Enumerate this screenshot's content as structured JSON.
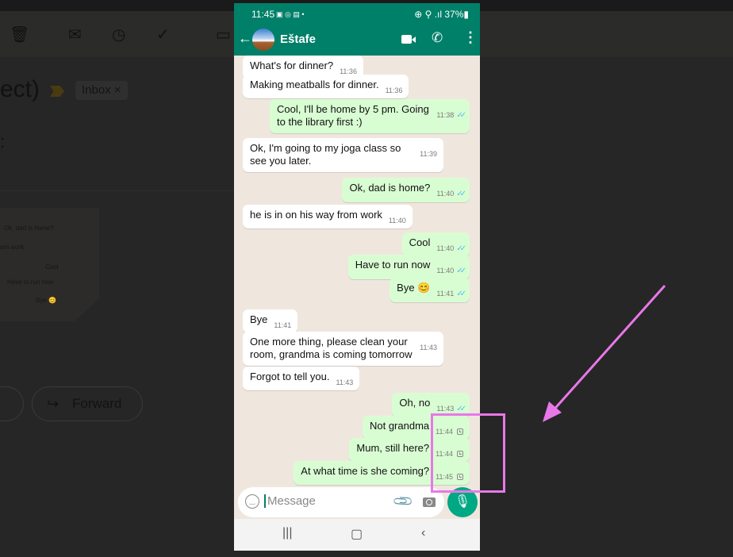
{
  "background_email": {
    "toolbar_icons": [
      "trash-icon",
      "mail-icon",
      "clock-icon",
      "add-task-icon",
      "move-to-folder-icon"
    ],
    "subject_fragment": "ect)",
    "label_chip": "Inbox",
    "label_chip_close": "×",
    "colon": ":",
    "thumbnail_messages": [
      {
        "text": "Ok, dad is home?",
        "time": "11:40"
      },
      {
        "text": "om work",
        "time": "11:40"
      },
      {
        "text": "Cool",
        "time": "11:40"
      },
      {
        "text": "Have to run now",
        "time": "11:40"
      },
      {
        "text": "Bye 😊",
        "time": "11:41"
      }
    ],
    "forward_label": "Forward"
  },
  "phone": {
    "status": {
      "time": "11:45",
      "icons": "▣ ◎ ▤ •",
      "right": "⊕ ⚲ .ıl 37%▮",
      "battery": "37%"
    },
    "header": {
      "contact_name": "Eštafe"
    },
    "messages": [
      {
        "dir": "in",
        "text": "What's for dinner?",
        "time": "11:36"
      },
      {
        "dir": "in",
        "text": "Making meatballs for dinner.",
        "time": "11:36"
      },
      {
        "dir": "out",
        "text": "Cool, I'll be home by 5 pm. Going to the library first :)",
        "time": "11:38",
        "status": "read"
      },
      {
        "dir": "in",
        "text": "Ok, I'm going to my joga class so see you later.",
        "time": "11:39"
      },
      {
        "dir": "out",
        "text": "Ok, dad is home?",
        "time": "11:40",
        "status": "read"
      },
      {
        "dir": "in",
        "text": "he is in on his way from work",
        "time": "11:40"
      },
      {
        "dir": "out",
        "text": "Cool",
        "time": "11:40",
        "status": "read"
      },
      {
        "dir": "out",
        "text": "Have to run now",
        "time": "11:40",
        "status": "read"
      },
      {
        "dir": "out",
        "text": "Bye 😊",
        "time": "11:41",
        "status": "read"
      },
      {
        "dir": "in",
        "text": "Bye",
        "time": "11:41"
      },
      {
        "dir": "in",
        "text": "One more thing, please clean your room, grandma is coming tomorrow",
        "time": "11:43"
      },
      {
        "dir": "in",
        "text": "Forgot to tell you.",
        "time": "11:43"
      },
      {
        "dir": "out",
        "text": "Oh, no",
        "time": "11:43",
        "status": "read"
      },
      {
        "dir": "out",
        "text": "Not grandma",
        "time": "11:44",
        "status": "pending"
      },
      {
        "dir": "out",
        "text": "Mum, still here?",
        "time": "11:44",
        "status": "pending"
      },
      {
        "dir": "out",
        "text": "At what time is she coming?",
        "time": "11:45",
        "status": "pending"
      }
    ],
    "input": {
      "placeholder": "Message",
      "value": ""
    },
    "colors": {
      "brand": "#008069",
      "outgoing": "#d9fdd3",
      "read_tick": "#53bdeb",
      "mic": "#00a884",
      "annotation": "#e878e8"
    }
  }
}
